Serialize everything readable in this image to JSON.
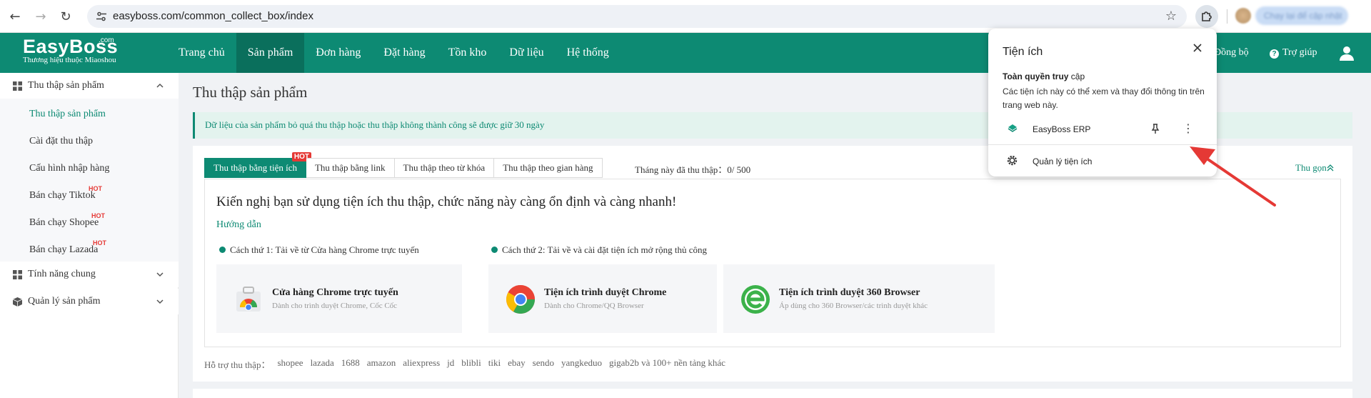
{
  "browser": {
    "url": "easyboss.com/common_collect_box/index",
    "profile_label": "Chạy lại để cập nhật"
  },
  "header": {
    "brand": "EasyBoss",
    "brand_suffix": ".com",
    "tagline": "Thương hiệu thuộc Miaoshou",
    "menu": [
      "Trang chủ",
      "Sản phẩm",
      "Đơn hàng",
      "Đặt hàng",
      "Tồn kho",
      "Dữ liệu",
      "Hệ thống"
    ],
    "sync_label": "Đồng bộ",
    "help_label": "Trợ giúp"
  },
  "sidebar": {
    "group1": "Thu thập sản phẩm",
    "items": [
      "Thu thập sản phẩm",
      "Cài đặt thu thập",
      "Cấu hình nhập hàng",
      "Bán chạy Tiktok",
      "Bán chạy Shopee",
      "Bán chạy Lazada"
    ],
    "hot": "HOT",
    "group2": "Tính năng chung",
    "group3": "Quản lý sản phẩm"
  },
  "main": {
    "title": "Thu thập sản phẩm",
    "notice": "Dữ liệu của sản phẩm bỏ quá thu thập hoặc thu thập không thành công sẽ được giữ 30 ngày",
    "tabs": [
      "Thu thập bằng tiện ích",
      "Thu thập bằng link",
      "Thu thập theo từ khóa",
      "Thu thập theo gian hàng"
    ],
    "tab_hot": "HOT",
    "month_label": "Tháng này đã thu thập：",
    "month_value": "0/ 500",
    "collapse": "Thu gọn",
    "recommend": "Kiến nghị bạn sử dụng tiện ích thu thập, chức năng này càng ổn định và càng nhanh!",
    "guide": "Hướng dẫn",
    "method1": "Cách thứ 1: Tải về từ Cửa hàng Chrome trực tuyến",
    "method2": "Cách thứ 2: Tải về và cài đặt tiện ích mở rộng thủ công",
    "options": [
      {
        "title": "Cửa hàng Chrome trực tuyến",
        "desc": "Dành cho trình duyệt Chrome, Cốc Cốc"
      },
      {
        "title": "Tiện ích trình duyệt Chrome",
        "desc": "Dành cho Chrome/QQ Browser"
      },
      {
        "title": "Tiện ích trình duyệt 360 Browser",
        "desc": "Áp dùng cho 360 Browser/các trình duyệt khác"
      }
    ],
    "support_label": "Hỗ trợ thu thập：",
    "platforms": [
      "shopee",
      "lazada",
      "1688",
      "amazon",
      "aliexpress",
      "jd",
      "blibli",
      "tiki",
      "ebay",
      "sendo",
      "yangkeduo",
      "gigab2b và 100+ nền tảng khác"
    ]
  },
  "popup": {
    "title": "Tiện ích",
    "heading_prefix": "Toàn quyền ",
    "heading_bold": "truy",
    "heading_suffix": " cập",
    "desc": "Các tiện ích này có thể xem và thay đổi thông tin trên trang web này.",
    "extension": "EasyBoss ERP",
    "manage": "Quản lý tiện ích"
  },
  "colors": {
    "brand": "#0d8a73",
    "hot": "#e53935",
    "arrow": "#e53935"
  }
}
